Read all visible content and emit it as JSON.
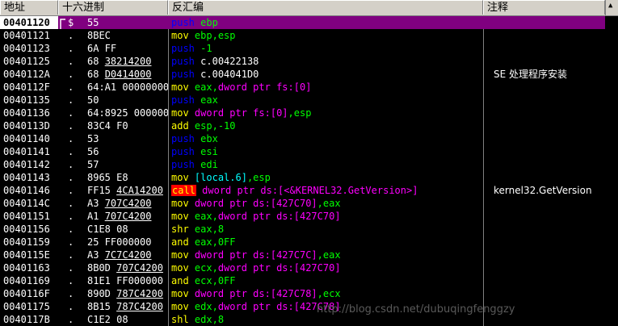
{
  "header": {
    "col_address": "地址",
    "col_hex": "十六进制",
    "col_disasm": "反汇编",
    "col_comment": "注释"
  },
  "rows": [
    {
      "addr": "00401120",
      "mark": "",
      "hex": [
        "55",
        ""
      ],
      "mnem": "push",
      "mclass": "push",
      "ops": [
        {
          "t": "ebp",
          "c": "reg"
        }
      ],
      "comment": "",
      "selected": true
    },
    {
      "addr": "00401121",
      "mark": ".",
      "hex": [
        "8BEC",
        ""
      ],
      "mnem": "mov",
      "mclass": "mov",
      "ops": [
        {
          "t": "ebp,esp",
          "c": "reg"
        }
      ],
      "comment": ""
    },
    {
      "addr": "00401123",
      "mark": ".",
      "hex": [
        "6A FF",
        ""
      ],
      "mnem": "push",
      "mclass": "push",
      "ops": [
        {
          "t": "-1",
          "c": "imm"
        }
      ],
      "comment": ""
    },
    {
      "addr": "00401125",
      "mark": ".",
      "hex": [
        "68 ",
        "38214200"
      ],
      "mnem": "push",
      "mclass": "push",
      "ops": [
        {
          "t": "c.00422138",
          "c": "str"
        }
      ],
      "comment": ""
    },
    {
      "addr": "0040112A",
      "mark": ".",
      "hex": [
        "68 ",
        "D0414000"
      ],
      "mnem": "push",
      "mclass": "push",
      "ops": [
        {
          "t": "c.004041D0",
          "c": "str"
        }
      ],
      "comment": "SE 处理程序安装"
    },
    {
      "addr": "0040112F",
      "mark": ".",
      "hex": [
        "64:A1 00000000",
        ""
      ],
      "mnem": "mov",
      "mclass": "mov",
      "ops": [
        {
          "t": "eax,",
          "c": "reg"
        },
        {
          "t": "dword ptr fs:[0]",
          "c": "mem"
        }
      ],
      "comment": ""
    },
    {
      "addr": "00401135",
      "mark": ".",
      "hex": [
        "50",
        ""
      ],
      "mnem": "push",
      "mclass": "push",
      "ops": [
        {
          "t": "eax",
          "c": "reg"
        }
      ],
      "comment": ""
    },
    {
      "addr": "00401136",
      "mark": ".",
      "hex": [
        "64:8925 00000000",
        ""
      ],
      "mnem": "mov",
      "mclass": "mov",
      "ops": [
        {
          "t": "dword ptr fs:[0]",
          "c": "mem"
        },
        {
          "t": ",esp",
          "c": "reg"
        }
      ],
      "comment": ""
    },
    {
      "addr": "0040113D",
      "mark": ".",
      "hex": [
        "83C4 F0",
        ""
      ],
      "mnem": "add",
      "mclass": "add",
      "ops": [
        {
          "t": "esp,-10",
          "c": "reg"
        }
      ],
      "comment": ""
    },
    {
      "addr": "00401140",
      "mark": ".",
      "hex": [
        "53",
        ""
      ],
      "mnem": "push",
      "mclass": "push",
      "ops": [
        {
          "t": "ebx",
          "c": "reg"
        }
      ],
      "comment": ""
    },
    {
      "addr": "00401141",
      "mark": ".",
      "hex": [
        "56",
        ""
      ],
      "mnem": "push",
      "mclass": "push",
      "ops": [
        {
          "t": "esi",
          "c": "reg"
        }
      ],
      "comment": ""
    },
    {
      "addr": "00401142",
      "mark": ".",
      "hex": [
        "57",
        ""
      ],
      "mnem": "push",
      "mclass": "push",
      "ops": [
        {
          "t": "edi",
          "c": "reg"
        }
      ],
      "comment": ""
    },
    {
      "addr": "00401143",
      "mark": ".",
      "hex": [
        "8965 E8",
        ""
      ],
      "mnem": "mov",
      "mclass": "mov",
      "ops": [
        {
          "t": "[local.6]",
          "c": "local"
        },
        {
          "t": ",esp",
          "c": "reg"
        }
      ],
      "comment": ""
    },
    {
      "addr": "00401146",
      "mark": ".",
      "hex": [
        "FF15 ",
        "4CA14200"
      ],
      "mnem": "call",
      "mclass": "call",
      "ops": [
        {
          "t": "dword ptr ds:[<&KERNEL32.GetVersion>]",
          "c": "mem"
        }
      ],
      "comment": "kernel32.GetVersion"
    },
    {
      "addr": "0040114C",
      "mark": ".",
      "hex": [
        "A3 ",
        "707C4200"
      ],
      "mnem": "mov",
      "mclass": "mov",
      "ops": [
        {
          "t": "dword ptr ds:[427C70]",
          "c": "mem"
        },
        {
          "t": ",eax",
          "c": "reg"
        }
      ],
      "comment": ""
    },
    {
      "addr": "00401151",
      "mark": ".",
      "hex": [
        "A1 ",
        "707C4200"
      ],
      "mnem": "mov",
      "mclass": "mov",
      "ops": [
        {
          "t": "eax,",
          "c": "reg"
        },
        {
          "t": "dword ptr ds:[427C70]",
          "c": "mem"
        }
      ],
      "comment": ""
    },
    {
      "addr": "00401156",
      "mark": ".",
      "hex": [
        "C1E8 08",
        ""
      ],
      "mnem": "shr",
      "mclass": "shr",
      "ops": [
        {
          "t": "eax,8",
          "c": "reg"
        }
      ],
      "comment": ""
    },
    {
      "addr": "00401159",
      "mark": ".",
      "hex": [
        "25 FF000000",
        ""
      ],
      "mnem": "and",
      "mclass": "and",
      "ops": [
        {
          "t": "eax,0FF",
          "c": "reg"
        }
      ],
      "comment": ""
    },
    {
      "addr": "0040115E",
      "mark": ".",
      "hex": [
        "A3 ",
        "7C7C4200"
      ],
      "mnem": "mov",
      "mclass": "mov",
      "ops": [
        {
          "t": "dword ptr ds:[427C7C]",
          "c": "mem"
        },
        {
          "t": ",eax",
          "c": "reg"
        }
      ],
      "comment": ""
    },
    {
      "addr": "00401163",
      "mark": ".",
      "hex": [
        "8B0D ",
        "707C4200"
      ],
      "mnem": "mov",
      "mclass": "mov",
      "ops": [
        {
          "t": "ecx,",
          "c": "reg"
        },
        {
          "t": "dword ptr ds:[427C70]",
          "c": "mem"
        }
      ],
      "comment": ""
    },
    {
      "addr": "00401169",
      "mark": ".",
      "hex": [
        "81E1 FF000000",
        ""
      ],
      "mnem": "and",
      "mclass": "and",
      "ops": [
        {
          "t": "ecx,0FF",
          "c": "reg"
        }
      ],
      "comment": ""
    },
    {
      "addr": "0040116F",
      "mark": ".",
      "hex": [
        "890D ",
        "787C4200"
      ],
      "mnem": "mov",
      "mclass": "mov",
      "ops": [
        {
          "t": "dword ptr ds:[427C78]",
          "c": "mem"
        },
        {
          "t": ",ecx",
          "c": "reg"
        }
      ],
      "comment": ""
    },
    {
      "addr": "00401175",
      "mark": ".",
      "hex": [
        "8B15 ",
        "787C4200"
      ],
      "mnem": "mov",
      "mclass": "mov",
      "ops": [
        {
          "t": "edx,",
          "c": "reg"
        },
        {
          "t": "dword ptr ds:[427C78]",
          "c": "mem"
        }
      ],
      "comment": ""
    },
    {
      "addr": "0040117B",
      "mark": ".",
      "hex": [
        "C1E2 08",
        ""
      ],
      "mnem": "shl",
      "mclass": "shl",
      "ops": [
        {
          "t": "edx,8",
          "c": "reg"
        }
      ],
      "comment": ""
    }
  ],
  "selected_mark": "$",
  "watermark": "http://blog.csdn.net/dubuqingfenggzy"
}
